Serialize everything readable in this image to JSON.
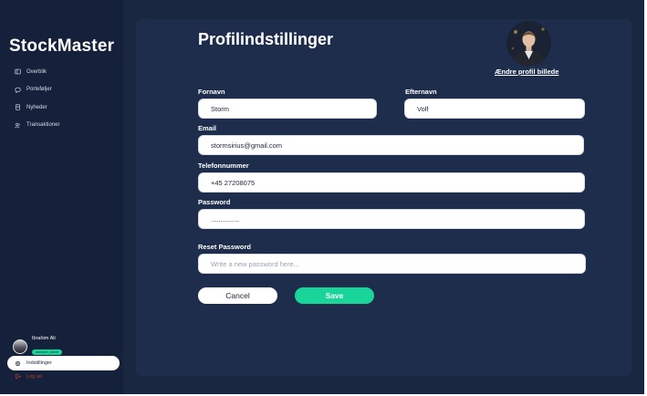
{
  "app": {
    "brand": "StockMaster"
  },
  "sidebar": {
    "items": [
      {
        "label": "Overblik",
        "icon": "overview-icon"
      },
      {
        "label": "Porteføljer",
        "icon": "chat-bubble-icon"
      },
      {
        "label": "Nyheder",
        "icon": "news-icon"
      },
      {
        "label": "Transaktioner",
        "icon": "users-icon"
      }
    ],
    "user": {
      "name": "Ibrahim Ali",
      "badge": "account_name"
    },
    "active_item": {
      "label": "Indstillinger",
      "icon": "gear-icon"
    },
    "logout": {
      "label": "Log ud",
      "icon": "logout-icon"
    }
  },
  "page": {
    "title": "Profilindstillinger",
    "change_photo_label": "Ændre profil billede"
  },
  "form": {
    "first_name": {
      "label": "Fornavn",
      "value": "Storm"
    },
    "last_name": {
      "label": "Efternavn",
      "value": "Volf"
    },
    "email": {
      "label": "Email",
      "value": "stormsirius@gmail.com"
    },
    "phone": {
      "label": "Telefonnummer",
      "value": "+45 27208075"
    },
    "password": {
      "label": "Password",
      "value": "..............."
    },
    "reset_password": {
      "label": "Reset Password",
      "placeholder": "Write a new password here..."
    }
  },
  "actions": {
    "cancel_label": "Cancel",
    "save_label": "Save"
  },
  "colors": {
    "background": "#1a2740",
    "sidebar": "#15203a",
    "card": "#1e2d4c",
    "accent": "#1ad59a",
    "logout": "#c0392b"
  }
}
